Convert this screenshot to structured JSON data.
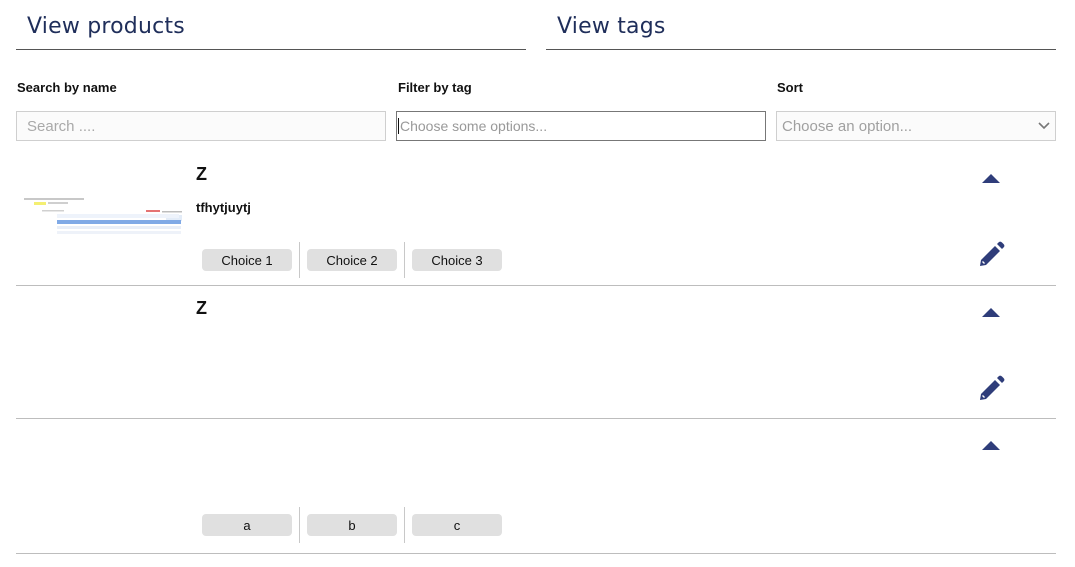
{
  "tabs": {
    "products": "View products",
    "tags": "View tags"
  },
  "filters": {
    "search_label": "Search by name",
    "search_placeholder": "Search ....",
    "tag_label": "Filter by tag",
    "tag_placeholder": "Choose some options...",
    "sort_label": "Sort",
    "sort_placeholder": "Choose an option..."
  },
  "products": [
    {
      "name": "Z",
      "description": "tfhytjuytj",
      "has_image": true,
      "tags": [
        "Choice 1",
        "Choice 2",
        "Choice 3"
      ],
      "editable": true
    },
    {
      "name": "Z",
      "description": "",
      "has_image": false,
      "tags": [],
      "editable": true
    },
    {
      "name": "",
      "description": "",
      "has_image": false,
      "tags": [
        "a",
        "b",
        "c"
      ],
      "editable": false
    }
  ],
  "icons": {
    "collapse": "caret-up-icon",
    "edit": "pencil-icon",
    "sort_dropdown": "chevron-down-icon"
  },
  "colors": {
    "accent": "#2f3d7a",
    "heading": "#1f2e5a",
    "chip_bg": "#e0e0e0"
  }
}
